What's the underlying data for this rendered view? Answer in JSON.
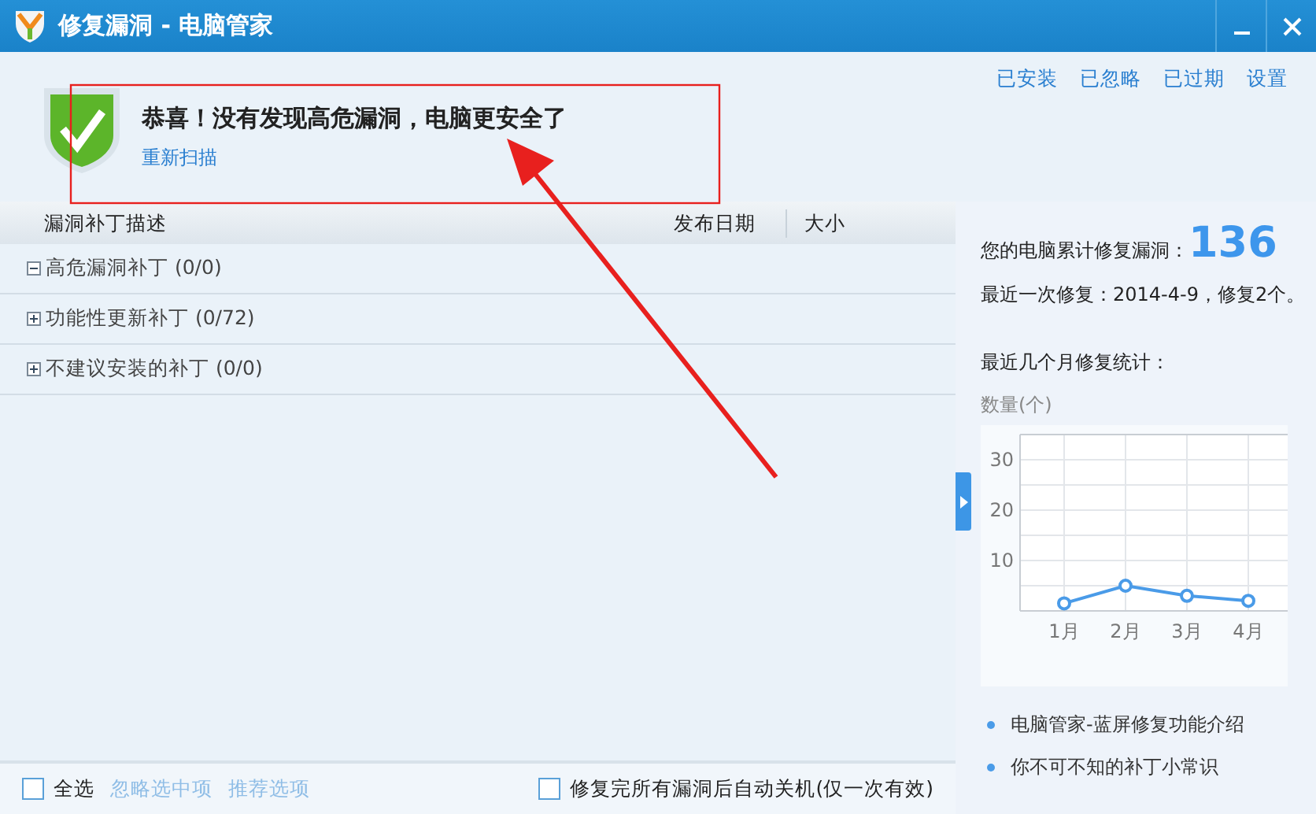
{
  "window": {
    "title": "修复漏洞 - 电脑管家"
  },
  "header": {
    "message": "恭喜！没有发现高危漏洞，电脑更安全了",
    "rescan_link": "重新扫描",
    "links": [
      "已安装",
      "已忽略",
      "已过期",
      "设置"
    ]
  },
  "table": {
    "columns": [
      "漏洞补丁描述",
      "发布日期",
      "大小"
    ],
    "groups": [
      {
        "label": "高危漏洞补丁 (0/0)",
        "expanded": true
      },
      {
        "label": "功能性更新补丁 (0/72)",
        "expanded": false
      },
      {
        "label": "不建议安装的补丁 (0/0)",
        "expanded": false
      }
    ]
  },
  "footer": {
    "select_all": {
      "label": "全选",
      "checked": false
    },
    "actions": [
      "忽略选中项",
      "推荐选项"
    ],
    "auto_shutdown": {
      "label": "修复完所有漏洞后自动关机(仅一次有效)",
      "checked": false
    }
  },
  "stats": {
    "total_label": "您的电脑累计修复漏洞：",
    "total": "136",
    "last_fix": "最近一次修复：2014-4-9，修复2个。",
    "chart_title": "最近几个月修复统计：",
    "chart_data": {
      "type": "line",
      "ylabel": "数量(个)",
      "categories": [
        "1月",
        "2月",
        "3月",
        "4月"
      ],
      "series": [
        {
          "color": "#4a9be8",
          "marker": "circle",
          "values": [
            1.5,
            5,
            3,
            2
          ]
        }
      ],
      "grid": true,
      "ylim": [
        0,
        35
      ],
      "yticks": [
        10,
        20,
        30
      ]
    },
    "links": [
      "电脑管家-蓝屏修复功能介绍",
      "你不可不知的补丁小常识"
    ]
  }
}
